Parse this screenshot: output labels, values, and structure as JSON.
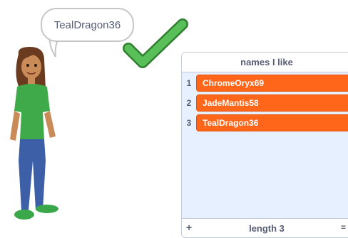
{
  "speech": {
    "text": "TealDragon36"
  },
  "list_monitor": {
    "title": "names I like",
    "items": [
      {
        "index": "1",
        "value": "ChromeOryx69"
      },
      {
        "index": "2",
        "value": "JadeMantis58"
      },
      {
        "index": "3",
        "value": "TealDragon36"
      }
    ],
    "add_label": "+",
    "length_label": "length 3",
    "resize_label": "="
  },
  "colors": {
    "item_bg": "#ff661a",
    "list_bg": "#e6f0ff",
    "check_green": "#59c059"
  },
  "icons": {
    "check": "checkmark-icon"
  }
}
